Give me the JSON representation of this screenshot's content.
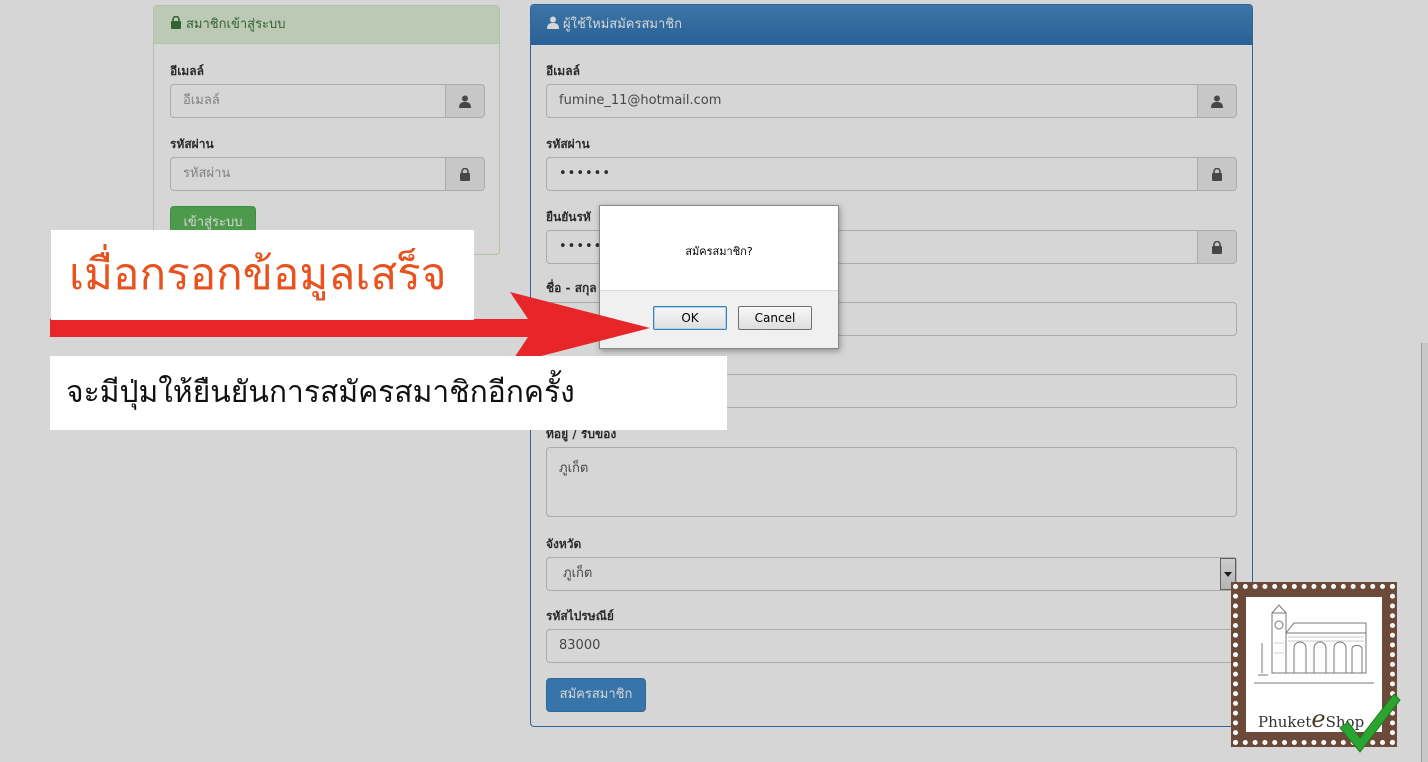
{
  "login": {
    "title": "สมาชิกเข้าสู่ระบบ",
    "email_label": "อีเมลล์",
    "email_placeholder": "อีเมลล์",
    "password_label": "รหัสผ่าน",
    "password_placeholder": "รหัสผ่าน",
    "submit": "เข้าสู่ระบบ"
  },
  "register": {
    "title": "ผู้ใช้ใหม่สมัครสมาชิก",
    "email_label": "อีเมลล์",
    "email_value": "fumine_11@hotmail.com",
    "password_label": "รหัสผ่าน",
    "password_value": "••••••",
    "confirm_label": "ยืนยันรหั",
    "confirm_value": "••••••",
    "name_label": "ชื่อ - สกุล",
    "address_label": "ที่อยู่ / รับของ",
    "address_value": "ภูเก็ต",
    "province_label": "จังหวัด",
    "province_value": "ภูเก็ต",
    "postcode_label": "รหัสไปรษณีย์",
    "postcode_value": "83000",
    "submit": "สมัครสมาชิก"
  },
  "dialog": {
    "message": "สมัครสมาชิก?",
    "ok": "OK",
    "cancel": "Cancel"
  },
  "annotation": {
    "line1": "เมื่อกรอกข้อมูลเสร็จ",
    "line2": "จะมีปุ่มให้ยืนยันการสมัครสมาชิกอีกครั้ง",
    "line1_color": "#e8521f",
    "arrow_color": "#e8262a"
  },
  "logo": {
    "text_left": "Phuket",
    "text_e": "e",
    "text_right": "Shop",
    "check_color": "#2aa52f"
  },
  "icons": {
    "lock": "lock-icon",
    "user": "user-icon",
    "caret": "caret-down-icon",
    "check": "checkmark-icon"
  }
}
